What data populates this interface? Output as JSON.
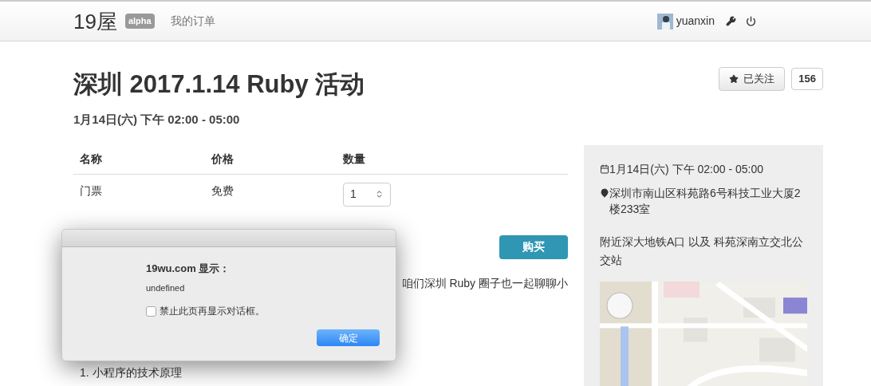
{
  "header": {
    "logo": "19屋",
    "badge": "alpha",
    "nav": [
      {
        "label": "我的订单",
        "selected": false
      }
    ],
    "user": {
      "name": "yuanxin"
    }
  },
  "event": {
    "title": "深圳 2017.1.14 Ruby 活动",
    "follow_button": "已关注",
    "follow_count": "156",
    "date": "1月14日(六) 下午 02:00 - 05:00",
    "tickets": {
      "columns": [
        "名称",
        "价格",
        "数量"
      ],
      "rows": [
        {
          "name": "门票",
          "price": "免费",
          "quantity": "1"
        }
      ]
    },
    "buy_button": "购买",
    "description": "咱们深圳 Ruby 圈子也一起聊聊小",
    "list": [
      "1. 小程序的技术原理"
    ]
  },
  "sidebar": {
    "date": "1月14日(六) 下午 02:00 - 05:00",
    "address": "深圳市南山区科苑路6号科技工业大厦2楼233室",
    "transit": "附近深大地铁A口 以及 科苑深南立交北公交站"
  },
  "dialog": {
    "title": "19wu.com 显示：",
    "message": "undefined",
    "checkbox": {
      "label": "禁止此页再显示对话框。",
      "checked": false
    },
    "ok_button": "确定"
  }
}
